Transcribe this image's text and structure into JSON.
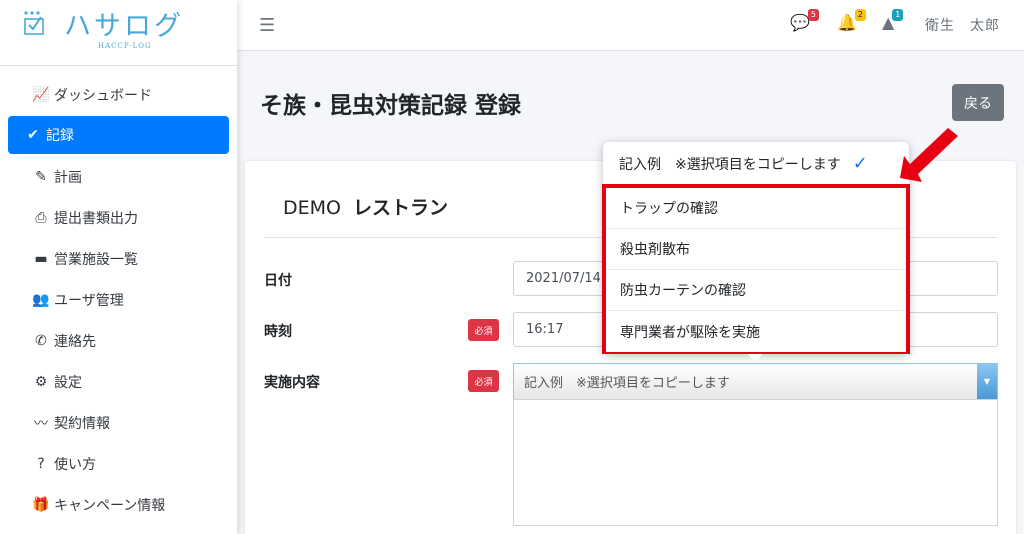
{
  "brand": {
    "name": "ハサログ",
    "sub": "HACCP-LOG"
  },
  "sidebar": {
    "items": [
      {
        "label": "ダッシュボード",
        "icon": "chart-line-icon"
      },
      {
        "label": "記録",
        "icon": "check-icon",
        "active": true
      },
      {
        "label": "計画",
        "icon": "edit-icon"
      },
      {
        "label": "提出書類出力",
        "icon": "print-icon"
      },
      {
        "label": "営業施設一覧",
        "icon": "store-icon"
      },
      {
        "label": "ユーザ管理",
        "icon": "users-icon"
      },
      {
        "label": "連絡先",
        "icon": "phone-icon"
      },
      {
        "label": "設定",
        "icon": "cogs-icon"
      },
      {
        "label": "契約情報",
        "icon": "signature-icon"
      },
      {
        "label": "使い方",
        "icon": "question-circle-icon"
      },
      {
        "label": "キャンペーン情報",
        "icon": "gift-icon"
      }
    ]
  },
  "topbar": {
    "comments_badge": "5",
    "bell_badge": "2",
    "alert_badge": "1",
    "user_name": "衛生　太郎"
  },
  "page": {
    "title": "そ族・昆虫対策記録 登録",
    "back_label": "戻る",
    "store_prefix": "DEMO",
    "store_name": "レストラン"
  },
  "form": {
    "date_label": "日付",
    "date_value": "2021/07/14",
    "time_label": "時刻",
    "time_value": "16:17",
    "content_label": "実施内容",
    "required_label": "必須",
    "select_value": "記入例　※選択項目をコピーします"
  },
  "dropdown": {
    "selected": "記入例　※選択項目をコピーします",
    "options": [
      "トラップの確認",
      "殺虫剤散布",
      "防虫カーテンの確認",
      "専門業者が駆除を実施"
    ]
  },
  "colors": {
    "primary": "#007bff",
    "danger": "#dc3545",
    "highlight": "#e60012",
    "brand": "#4aa8d8"
  }
}
